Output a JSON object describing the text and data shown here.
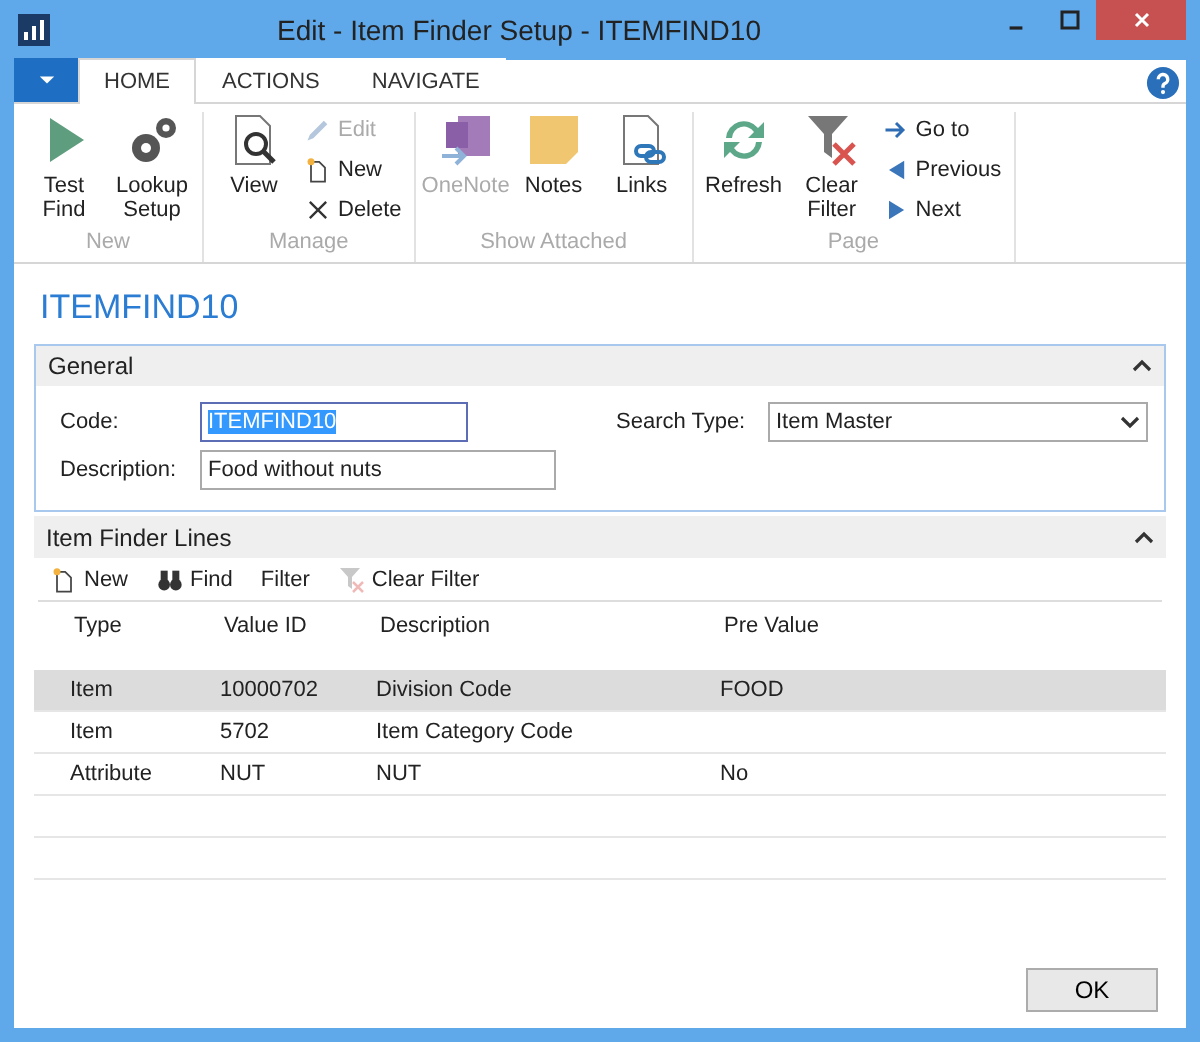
{
  "window": {
    "title": "Edit - Item Finder Setup - ITEMFIND10"
  },
  "tabs": [
    {
      "label": "HOME",
      "selected": true
    },
    {
      "label": "ACTIONS",
      "selected": false
    },
    {
      "label": "NAVIGATE",
      "selected": false
    }
  ],
  "ribbon": [
    {
      "label": "New",
      "large_buttons": [
        {
          "kind": "play",
          "label": "Test Find",
          "disabled": false
        },
        {
          "kind": "gears",
          "label": "Lookup Setup",
          "disabled": false
        }
      ]
    },
    {
      "label": "Manage",
      "large_buttons": [
        {
          "kind": "view",
          "label": "View",
          "disabled": false
        }
      ],
      "small_buttons": [
        {
          "kind": "pencil",
          "label": "Edit",
          "disabled": true
        },
        {
          "kind": "newdoc",
          "label": "New",
          "disabled": false
        },
        {
          "kind": "cross",
          "label": "Delete",
          "disabled": false
        }
      ]
    },
    {
      "label": "Show Attached",
      "large_buttons": [
        {
          "kind": "onenote",
          "label": "OneNote",
          "disabled": true
        },
        {
          "kind": "note",
          "label": "Notes",
          "disabled": false
        },
        {
          "kind": "links",
          "label": "Links",
          "disabled": false
        }
      ]
    },
    {
      "label": "Page",
      "large_buttons": [
        {
          "kind": "refresh",
          "label": "Refresh",
          "disabled": false
        },
        {
          "kind": "clearfilter",
          "label": "Clear Filter",
          "disabled": false
        }
      ],
      "small_buttons": [
        {
          "kind": "goto",
          "label": "Go to",
          "disabled": false
        },
        {
          "kind": "prev",
          "label": "Previous",
          "disabled": false
        },
        {
          "kind": "next",
          "label": "Next",
          "disabled": false
        }
      ]
    }
  ],
  "heading": "ITEMFIND10",
  "general": {
    "title": "General",
    "expanded": true,
    "code": {
      "label": "Code:",
      "value": "ITEMFIND10"
    },
    "description": {
      "label": "Description:",
      "value": "Food without nuts"
    },
    "search_type": {
      "label": "Search Type:",
      "value": "Item Master"
    }
  },
  "lines": {
    "title": "Item Finder Lines",
    "expanded": true,
    "toolbar": [
      {
        "kind": "newdoc",
        "label": "New",
        "disabled": false
      },
      {
        "kind": "binoculars",
        "label": "Find",
        "disabled": false
      },
      {
        "kind": "none",
        "label": "Filter",
        "disabled": false
      },
      {
        "kind": "clearfilter",
        "label": "Clear Filter",
        "disabled": true
      }
    ],
    "columns": [
      "Type",
      "Value ID",
      "Description",
      "Pre Value"
    ],
    "rows": [
      {
        "selected": true,
        "cells": [
          "Item",
          "10000702",
          "Division Code",
          "FOOD"
        ]
      },
      {
        "selected": false,
        "cells": [
          "Item",
          "5702",
          "Item Category Code",
          ""
        ]
      },
      {
        "selected": false,
        "cells": [
          "Attribute",
          "NUT",
          "NUT",
          "No"
        ]
      }
    ]
  },
  "footer": {
    "ok_button": "OK"
  }
}
